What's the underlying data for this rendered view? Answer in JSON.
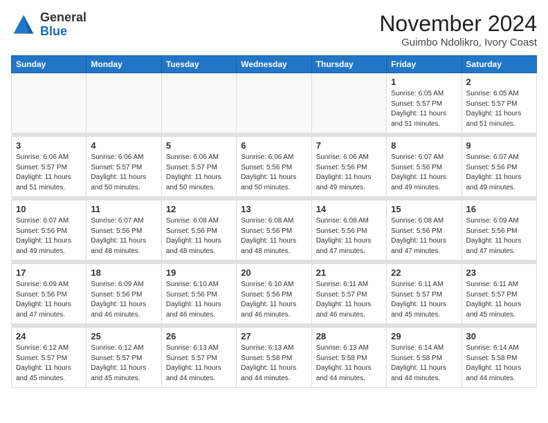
{
  "header": {
    "logo_general": "General",
    "logo_blue": "Blue",
    "month_title": "November 2024",
    "location": "Guimbo Ndolikro, Ivory Coast"
  },
  "weekdays": [
    "Sunday",
    "Monday",
    "Tuesday",
    "Wednesday",
    "Thursday",
    "Friday",
    "Saturday"
  ],
  "weeks": [
    [
      {
        "day": "",
        "info": ""
      },
      {
        "day": "",
        "info": ""
      },
      {
        "day": "",
        "info": ""
      },
      {
        "day": "",
        "info": ""
      },
      {
        "day": "",
        "info": ""
      },
      {
        "day": "1",
        "info": "Sunrise: 6:05 AM\nSunset: 5:57 PM\nDaylight: 11 hours and 51 minutes."
      },
      {
        "day": "2",
        "info": "Sunrise: 6:05 AM\nSunset: 5:57 PM\nDaylight: 11 hours and 51 minutes."
      }
    ],
    [
      {
        "day": "3",
        "info": "Sunrise: 6:06 AM\nSunset: 5:57 PM\nDaylight: 11 hours and 51 minutes."
      },
      {
        "day": "4",
        "info": "Sunrise: 6:06 AM\nSunset: 5:57 PM\nDaylight: 11 hours and 50 minutes."
      },
      {
        "day": "5",
        "info": "Sunrise: 6:06 AM\nSunset: 5:57 PM\nDaylight: 11 hours and 50 minutes."
      },
      {
        "day": "6",
        "info": "Sunrise: 6:06 AM\nSunset: 5:56 PM\nDaylight: 11 hours and 50 minutes."
      },
      {
        "day": "7",
        "info": "Sunrise: 6:06 AM\nSunset: 5:56 PM\nDaylight: 11 hours and 49 minutes."
      },
      {
        "day": "8",
        "info": "Sunrise: 6:07 AM\nSunset: 5:56 PM\nDaylight: 11 hours and 49 minutes."
      },
      {
        "day": "9",
        "info": "Sunrise: 6:07 AM\nSunset: 5:56 PM\nDaylight: 11 hours and 49 minutes."
      }
    ],
    [
      {
        "day": "10",
        "info": "Sunrise: 6:07 AM\nSunset: 5:56 PM\nDaylight: 11 hours and 49 minutes."
      },
      {
        "day": "11",
        "info": "Sunrise: 6:07 AM\nSunset: 5:56 PM\nDaylight: 11 hours and 48 minutes."
      },
      {
        "day": "12",
        "info": "Sunrise: 6:08 AM\nSunset: 5:56 PM\nDaylight: 11 hours and 48 minutes."
      },
      {
        "day": "13",
        "info": "Sunrise: 6:08 AM\nSunset: 5:56 PM\nDaylight: 11 hours and 48 minutes."
      },
      {
        "day": "14",
        "info": "Sunrise: 6:08 AM\nSunset: 5:56 PM\nDaylight: 11 hours and 47 minutes."
      },
      {
        "day": "15",
        "info": "Sunrise: 6:08 AM\nSunset: 5:56 PM\nDaylight: 11 hours and 47 minutes."
      },
      {
        "day": "16",
        "info": "Sunrise: 6:09 AM\nSunset: 5:56 PM\nDaylight: 11 hours and 47 minutes."
      }
    ],
    [
      {
        "day": "17",
        "info": "Sunrise: 6:09 AM\nSunset: 5:56 PM\nDaylight: 11 hours and 47 minutes."
      },
      {
        "day": "18",
        "info": "Sunrise: 6:09 AM\nSunset: 5:56 PM\nDaylight: 11 hours and 46 minutes."
      },
      {
        "day": "19",
        "info": "Sunrise: 6:10 AM\nSunset: 5:56 PM\nDaylight: 11 hours and 46 minutes."
      },
      {
        "day": "20",
        "info": "Sunrise: 6:10 AM\nSunset: 5:56 PM\nDaylight: 11 hours and 46 minutes."
      },
      {
        "day": "21",
        "info": "Sunrise: 6:11 AM\nSunset: 5:57 PM\nDaylight: 11 hours and 46 minutes."
      },
      {
        "day": "22",
        "info": "Sunrise: 6:11 AM\nSunset: 5:57 PM\nDaylight: 11 hours and 45 minutes."
      },
      {
        "day": "23",
        "info": "Sunrise: 6:11 AM\nSunset: 5:57 PM\nDaylight: 11 hours and 45 minutes."
      }
    ],
    [
      {
        "day": "24",
        "info": "Sunrise: 6:12 AM\nSunset: 5:57 PM\nDaylight: 11 hours and 45 minutes."
      },
      {
        "day": "25",
        "info": "Sunrise: 6:12 AM\nSunset: 5:57 PM\nDaylight: 11 hours and 45 minutes."
      },
      {
        "day": "26",
        "info": "Sunrise: 6:13 AM\nSunset: 5:57 PM\nDaylight: 11 hours and 44 minutes."
      },
      {
        "day": "27",
        "info": "Sunrise: 6:13 AM\nSunset: 5:58 PM\nDaylight: 11 hours and 44 minutes."
      },
      {
        "day": "28",
        "info": "Sunrise: 6:13 AM\nSunset: 5:58 PM\nDaylight: 11 hours and 44 minutes."
      },
      {
        "day": "29",
        "info": "Sunrise: 6:14 AM\nSunset: 5:58 PM\nDaylight: 11 hours and 44 minutes."
      },
      {
        "day": "30",
        "info": "Sunrise: 6:14 AM\nSunset: 5:58 PM\nDaylight: 11 hours and 44 minutes."
      }
    ]
  ]
}
